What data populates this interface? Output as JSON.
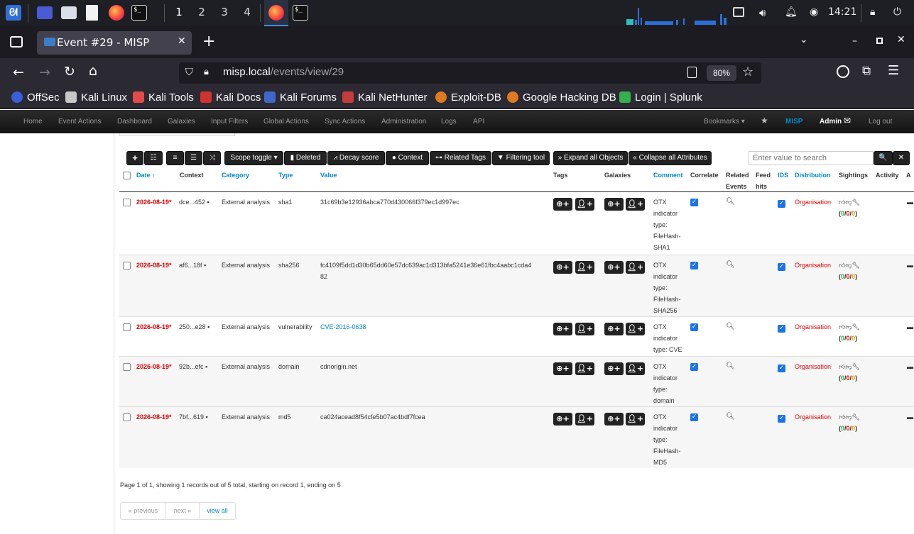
{
  "taskbar": {
    "workspaces": [
      "1",
      "2",
      "3",
      "4"
    ],
    "clock": "14:21"
  },
  "browser": {
    "tab_title": "Event #29 - MISP",
    "url_host": "misp.local",
    "url_path": "/events/view/29",
    "zoom": "80%",
    "bookmarks": [
      "OffSec",
      "Kali Linux",
      "Kali Tools",
      "Kali Docs",
      "Kali Forums",
      "Kali NetHunter",
      "Exploit-DB",
      "Google Hacking DB",
      "Login | Splunk"
    ]
  },
  "misp_nav": {
    "items": [
      "Home",
      "Event Actions",
      "Dashboard",
      "Galaxies",
      "Input Filters",
      "Global Actions",
      "Sync Actions",
      "Administration",
      "Logs",
      "API"
    ],
    "bookmarks": "Bookmarks ▾",
    "brand": "MISP",
    "user": "Admin",
    "logout": "Log out"
  },
  "toolbar": {
    "plus": "+",
    "list": "☰",
    "scope_toggle": "Scope toggle ▾",
    "deleted": "Deleted",
    "decay_score": "Decay score",
    "context": "Context",
    "related_tags": "Related Tags",
    "filtering_tool": "Filtering tool",
    "expand_all": "Expand all Objects",
    "collapse_all": "Collapse all Attributes",
    "search_placeholder": "Enter value to search",
    "search_btn": "🔍",
    "clear_btn": "✕"
  },
  "table": {
    "headers": {
      "date": "Date ↑",
      "context": "Context",
      "category": "Category",
      "type": "Type",
      "value": "Value",
      "tags": "Tags",
      "galaxies": "Galaxies",
      "comment": "Comment",
      "correlate": "Correlate",
      "related_1": "Related",
      "related_2": "Events",
      "feed_1": "Feed",
      "feed_2": "hits",
      "ids": "IDS",
      "distribution": "Distribution",
      "sightings": "Sightings",
      "activity": "Activity",
      "actions": "A"
    },
    "rows": [
      {
        "date": "2026-08-19*",
        "context": "dce...452",
        "category": "External analysis",
        "type": "sha1",
        "value_1": "31c69b3e12936abca770d430066f379ec1d997ec",
        "value_2": "",
        "comment": [
          "OTX",
          "indicator",
          "type:",
          "FileHash-",
          "SHA1"
        ],
        "distribution": "Organisation",
        "sight_a": "0",
        "sight_b": "0",
        "sight_c": "0"
      },
      {
        "date": "2026-08-19*",
        "context": "af6...18f",
        "category": "External analysis",
        "type": "sha256",
        "value_1": "fc4109f5dd1d30b65dd60e57dc639ac1d313bfa5241e36e61fbc4aabc1cda4",
        "value_2": "82",
        "comment": [
          "OTX",
          "indicator",
          "type:",
          "FileHash-",
          "SHA256"
        ],
        "distribution": "Organisation",
        "sight_a": "0",
        "sight_b": "0",
        "sight_c": "0"
      },
      {
        "date": "2026-08-19*",
        "context": "250...e28",
        "category": "External analysis",
        "type": "vulnerability",
        "value_1": "CVE-2016-0638",
        "value_2": "",
        "comment": [
          "OTX",
          "indicator",
          "type: CVE"
        ],
        "distribution": "Organisation",
        "sight_a": "0",
        "sight_b": "0",
        "sight_c": "0"
      },
      {
        "date": "2026-08-19*",
        "context": "92b...efc",
        "category": "External analysis",
        "type": "domain",
        "value_1": "cdnorigin.net",
        "value_2": "",
        "comment": [
          "OTX",
          "indicator",
          "type:",
          "domain"
        ],
        "distribution": "Organisation",
        "sight_a": "0",
        "sight_b": "0",
        "sight_c": "0"
      },
      {
        "date": "2026-08-19*",
        "context": "7bf...619",
        "category": "External analysis",
        "type": "md5",
        "value_1": "ca024acead8f54cfe5b07ac4bdf7fcea",
        "value_2": "",
        "comment": [
          "OTX",
          "indicator",
          "type:",
          "FileHash-",
          "MD5"
        ],
        "distribution": "Organisation",
        "sight_a": "0",
        "sight_b": "0",
        "sight_c": "0"
      }
    ]
  },
  "footer": {
    "summary": "Page 1 of 1, showing 1 records out of 5 total, starting on record 1, ending on 5",
    "previous": "« previous",
    "next": "next »",
    "view_all": "view all"
  }
}
